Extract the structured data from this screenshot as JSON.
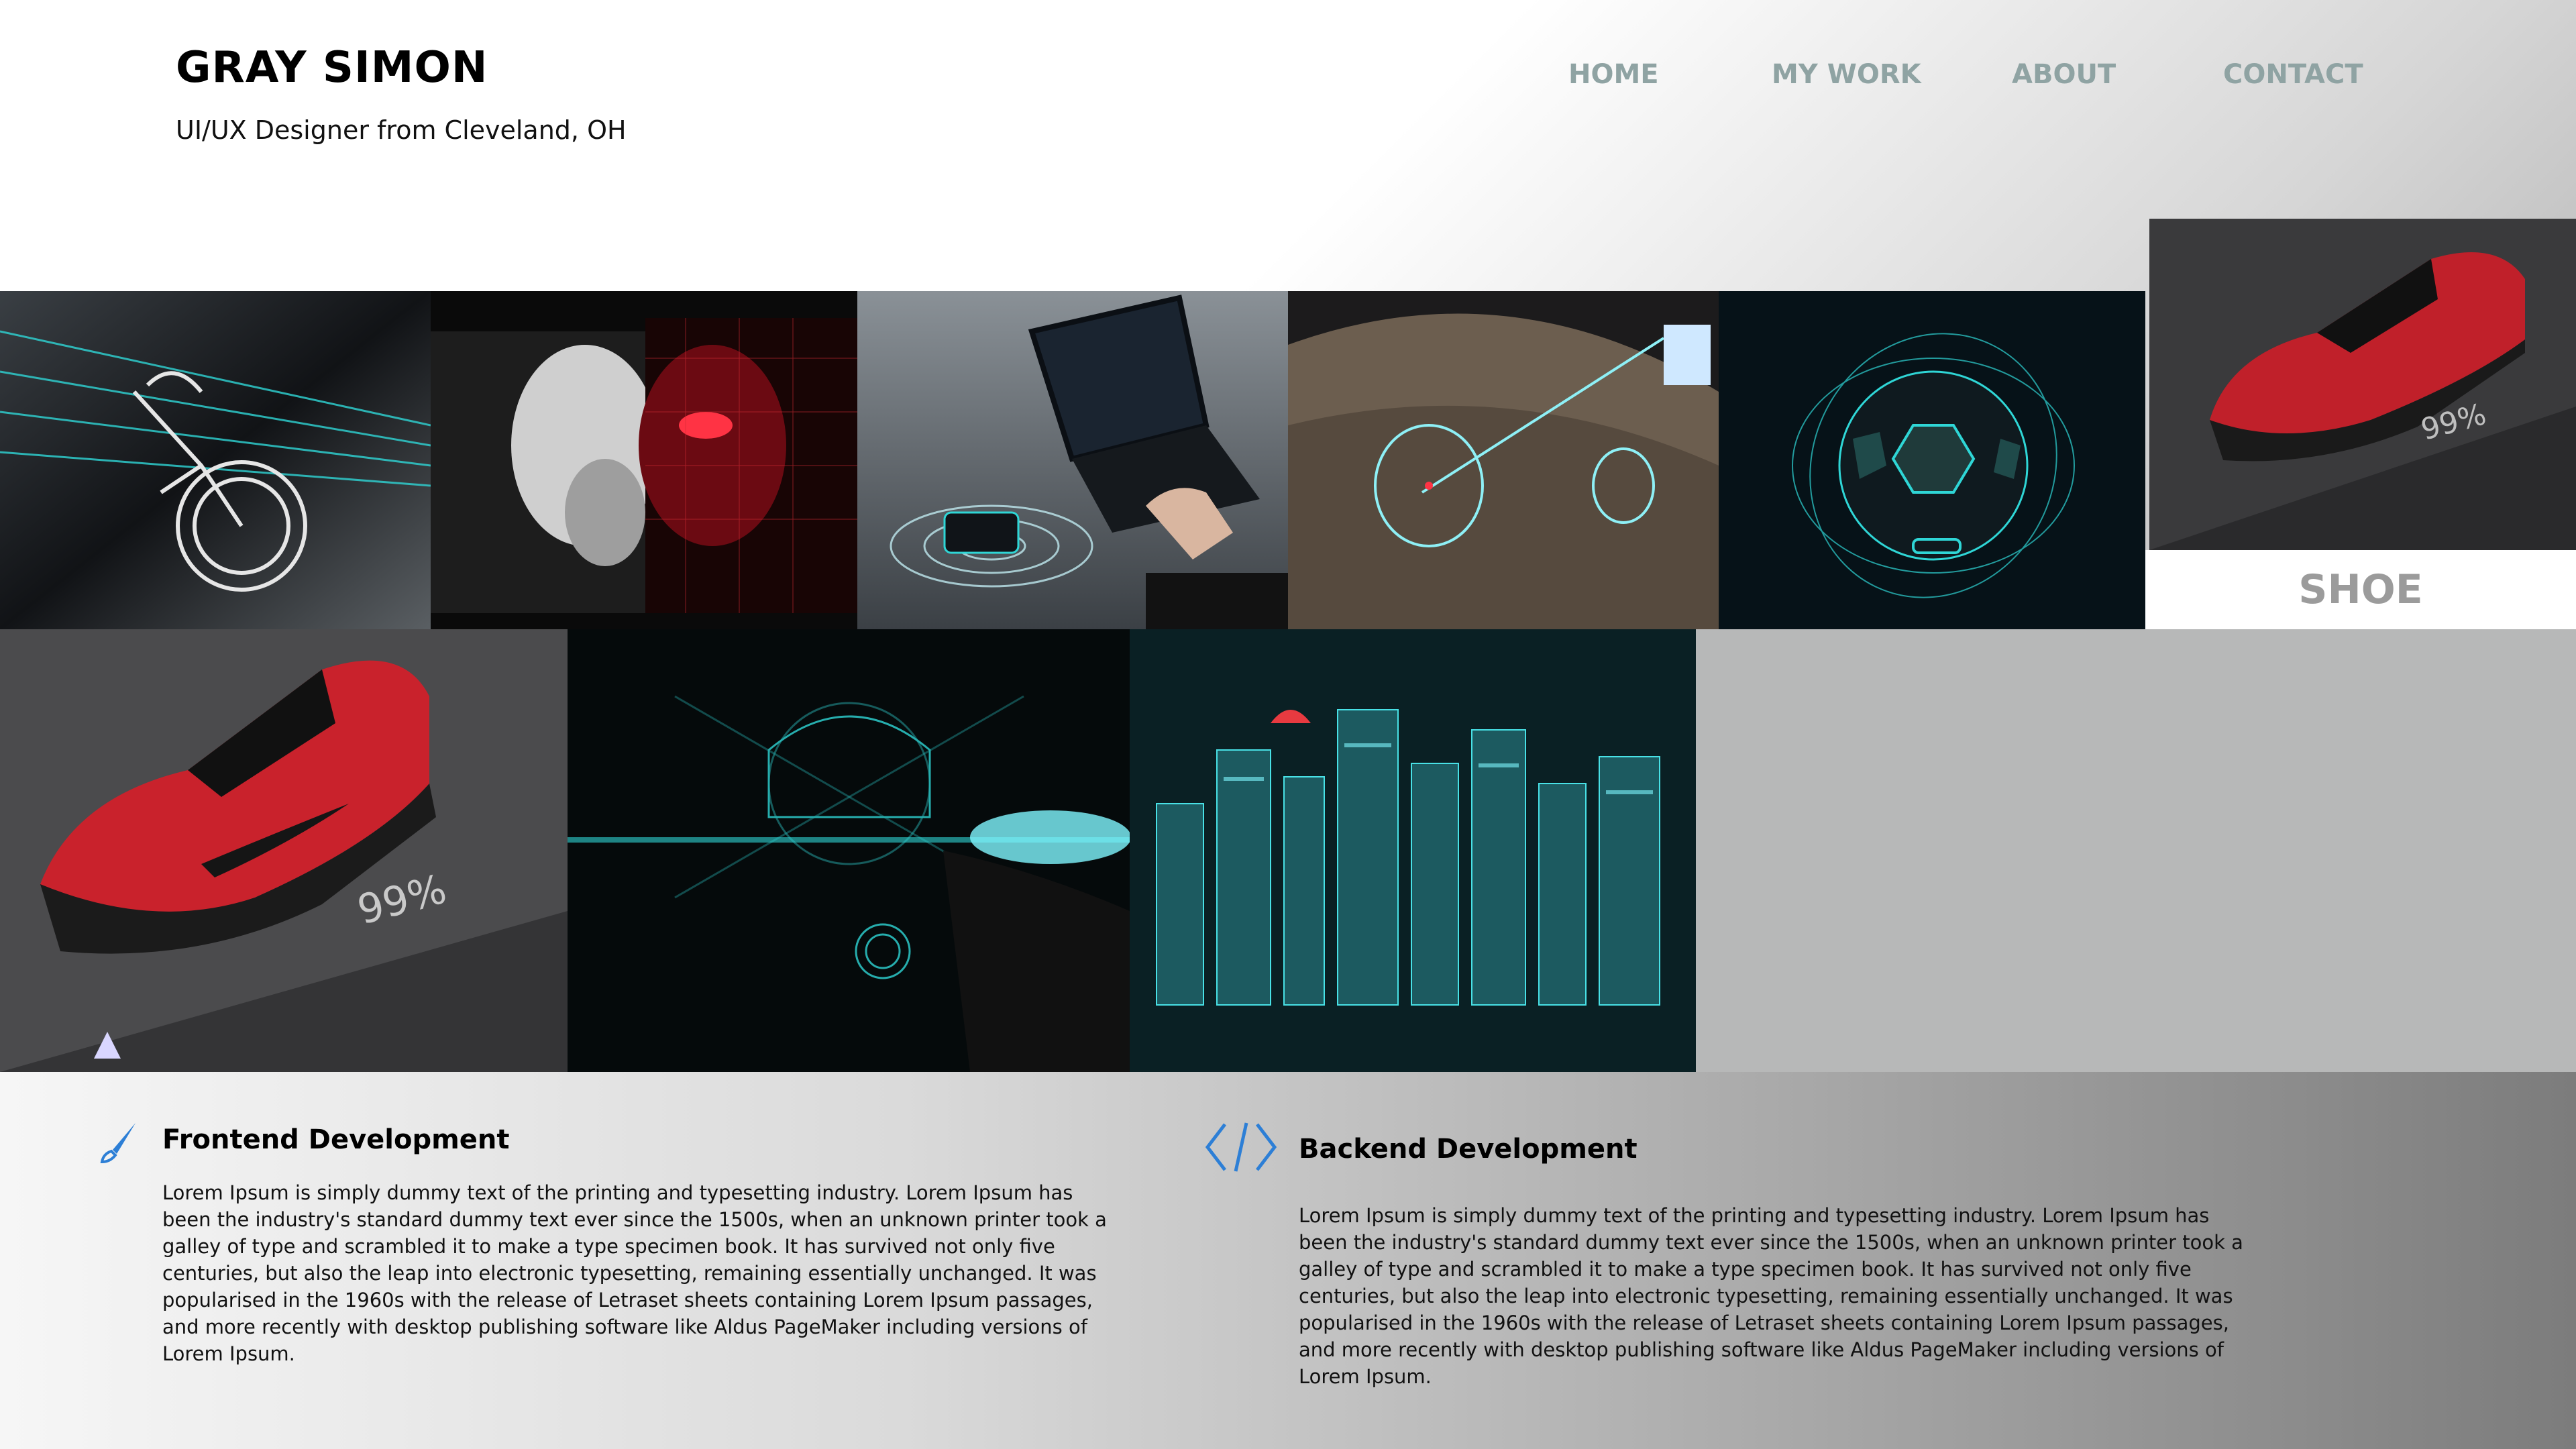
{
  "header": {
    "name": "GRAY SIMON",
    "subtitle": "UI/UX Designer from Cleveland, OH"
  },
  "nav": {
    "items": [
      "HOME",
      "MY WORK",
      "ABOUT",
      "CONTACT"
    ],
    "color": "#8fa3a3"
  },
  "gallery": {
    "tiles": [
      {
        "icon": "bike-hologram-image"
      },
      {
        "icon": "face-scan-image"
      },
      {
        "icon": "laptop-hologram-image"
      },
      {
        "icon": "globe-hud-image"
      },
      {
        "icon": "hexagon-sphere-image"
      },
      {
        "icon": "shoe-thumbnail-image"
      },
      {
        "icon": "shoe-large-image"
      },
      {
        "icon": "helmet-hud-image"
      },
      {
        "icon": "city-hologram-image"
      }
    ],
    "hover_label": "SHOE",
    "shoe_readout": "99%"
  },
  "services": [
    {
      "icon": "brush-icon",
      "title": "Frontend Development",
      "text": "Lorem Ipsum is simply dummy text of the printing and typesetting industry. Lorem Ipsum has been the industry's standard dummy text ever since the 1500s, when an unknown printer took a galley of type and scrambled it to make a type specimen book. It has survived not only five centuries, but also the leap into electronic typesetting, remaining essentially unchanged. It was popularised in the 1960s with the release of Letraset sheets containing Lorem Ipsum passages, and more recently with desktop publishing software like Aldus PageMaker including versions of Lorem Ipsum."
    },
    {
      "icon": "code-icon",
      "title": "Backend Development",
      "text": "Lorem Ipsum is simply dummy text of the printing and typesetting industry. Lorem Ipsum has been the industry's standard dummy text ever since the 1500s, when an unknown printer took a galley of type and scrambled it to make a type specimen book. It has survived not only five centuries, but also the leap into electronic typesetting, remaining essentially unchanged. It was popularised in the 1960s with the release of Letraset sheets containing Lorem Ipsum passages, and more recently with desktop publishing software like Aldus PageMaker including versions of Lorem Ipsum."
    }
  ],
  "colors": {
    "accent_blue": "#2d7fd6",
    "hologram_cyan": "#2fd6d6",
    "shoe_red": "#d42b35"
  }
}
